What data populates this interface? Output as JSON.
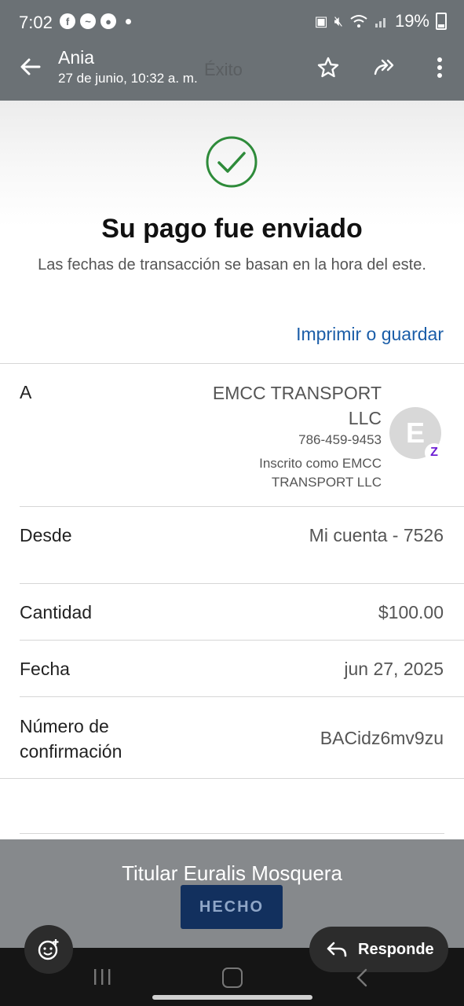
{
  "status_bar": {
    "time": "7:02",
    "battery": "19%",
    "notification_icons": [
      "facebook-icon",
      "messenger-icon",
      "profile-icon"
    ]
  },
  "viewer": {
    "sender": "Ania",
    "date": "27 de junio, 10:32 a. m."
  },
  "receipt": {
    "screen_title": "Éxito",
    "headline": "Su pago fue enviado",
    "subtext": "Las fechas de transacción se basan en la hora del este.",
    "print_link": "Imprimir o guardar",
    "to": {
      "label": "A",
      "name": "EMCC TRANSPORT LLC",
      "phone": "786-459-9453",
      "registered_as": "Inscrito como EMCC TRANSPORT LLC",
      "avatar_initial": "E",
      "badge": "Z"
    },
    "from": {
      "label": "Desde",
      "value": "Mi cuenta - 7526"
    },
    "amount": {
      "label": "Cantidad",
      "value": "$100.00"
    },
    "date": {
      "label": "Fecha",
      "value": "jun 27, 2025"
    },
    "confirmation": {
      "label": "Número de confirmación",
      "value": "BACidz6mv9zu"
    },
    "done_button": "HECHO"
  },
  "caption": "Titular Euralis Mosquera",
  "reply_button": "Responde",
  "colors": {
    "header_bg": "#6b7175",
    "link_blue": "#1a5da8",
    "check_green": "#2e8b3a",
    "done_button_bg": "#12305e",
    "zelle_purple": "#6d1ed4"
  }
}
